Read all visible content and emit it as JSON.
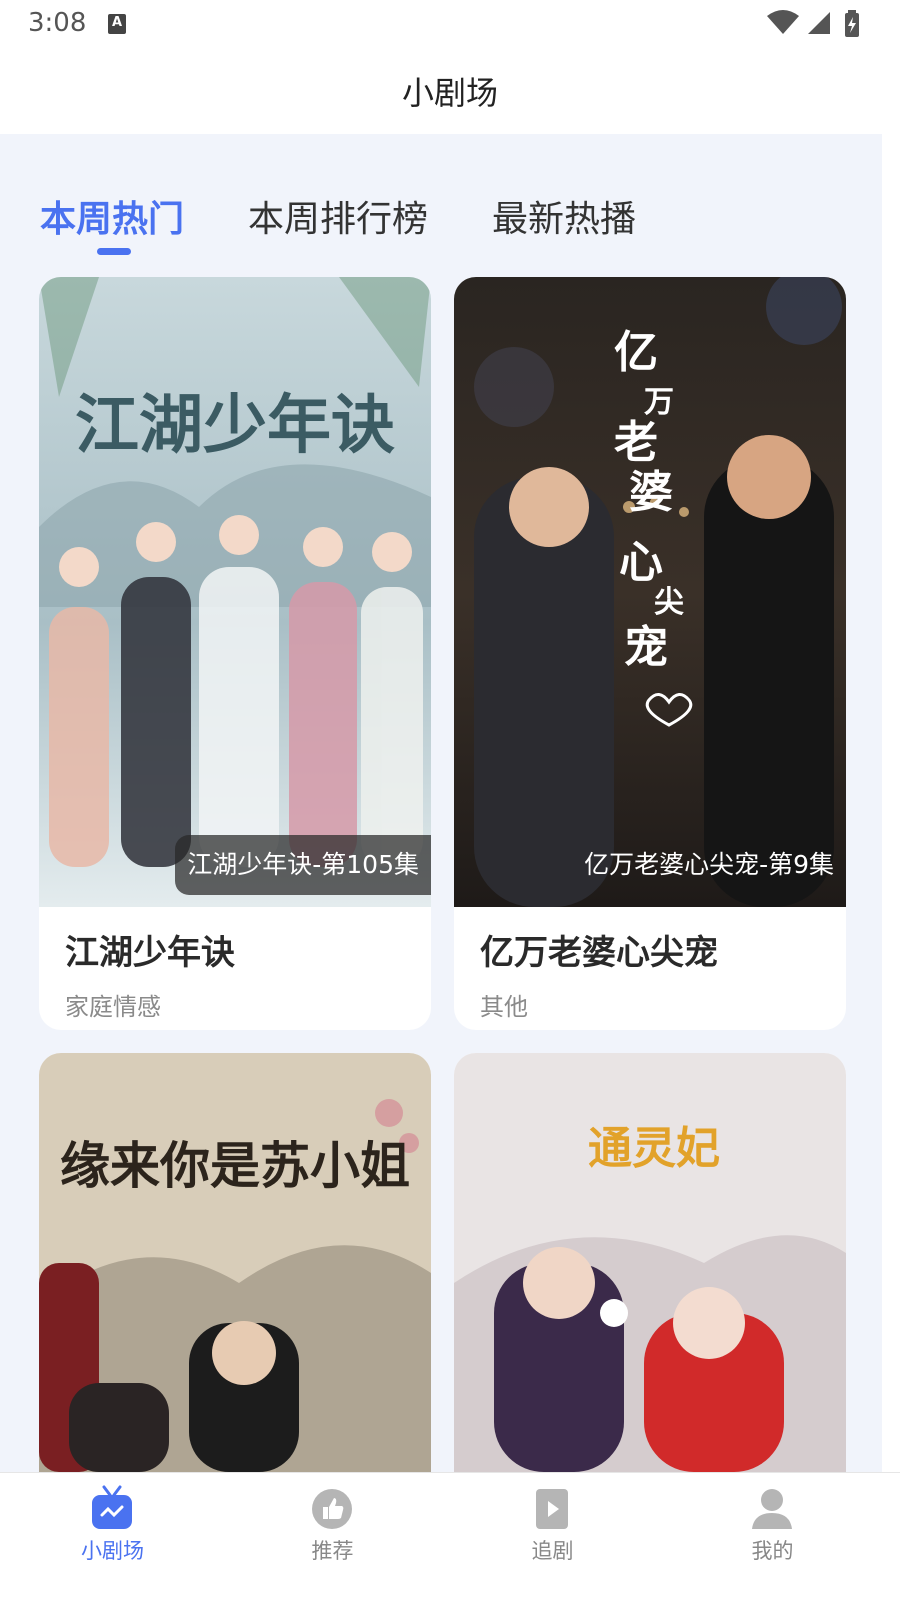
{
  "status_bar": {
    "time": "3:08",
    "a_icon": "A"
  },
  "header": {
    "title": "小剧场"
  },
  "tabs": [
    {
      "label": "本周热门",
      "active": true
    },
    {
      "label": "本周排行榜",
      "active": false
    },
    {
      "label": "最新热播",
      "active": false
    }
  ],
  "cards": [
    {
      "title": "江湖少年诀",
      "genre": "家庭情感",
      "episode_tag": "江湖少年诀-第105集",
      "poster_text": "江湖少年诀"
    },
    {
      "title": "亿万老婆心尖宠",
      "genre": "其他",
      "episode_tag": "亿万老婆心尖宠-第9集",
      "poster_text": "亿万老婆心尖宠"
    },
    {
      "title": "",
      "genre": "",
      "episode_tag": "",
      "poster_text": "缘来你是苏小姐"
    },
    {
      "title": "",
      "genre": "",
      "episode_tag": "",
      "poster_text": "通灵妃"
    }
  ],
  "bottom_nav": [
    {
      "label": "小剧场",
      "icon": "tv-icon",
      "active": true
    },
    {
      "label": "推荐",
      "icon": "thumbs-up-icon",
      "active": false
    },
    {
      "label": "追剧",
      "icon": "play-file-icon",
      "active": false
    },
    {
      "label": "我的",
      "icon": "user-icon",
      "active": false
    }
  ],
  "colors": {
    "accent": "#4a72f0",
    "background": "#f1f4fb"
  }
}
